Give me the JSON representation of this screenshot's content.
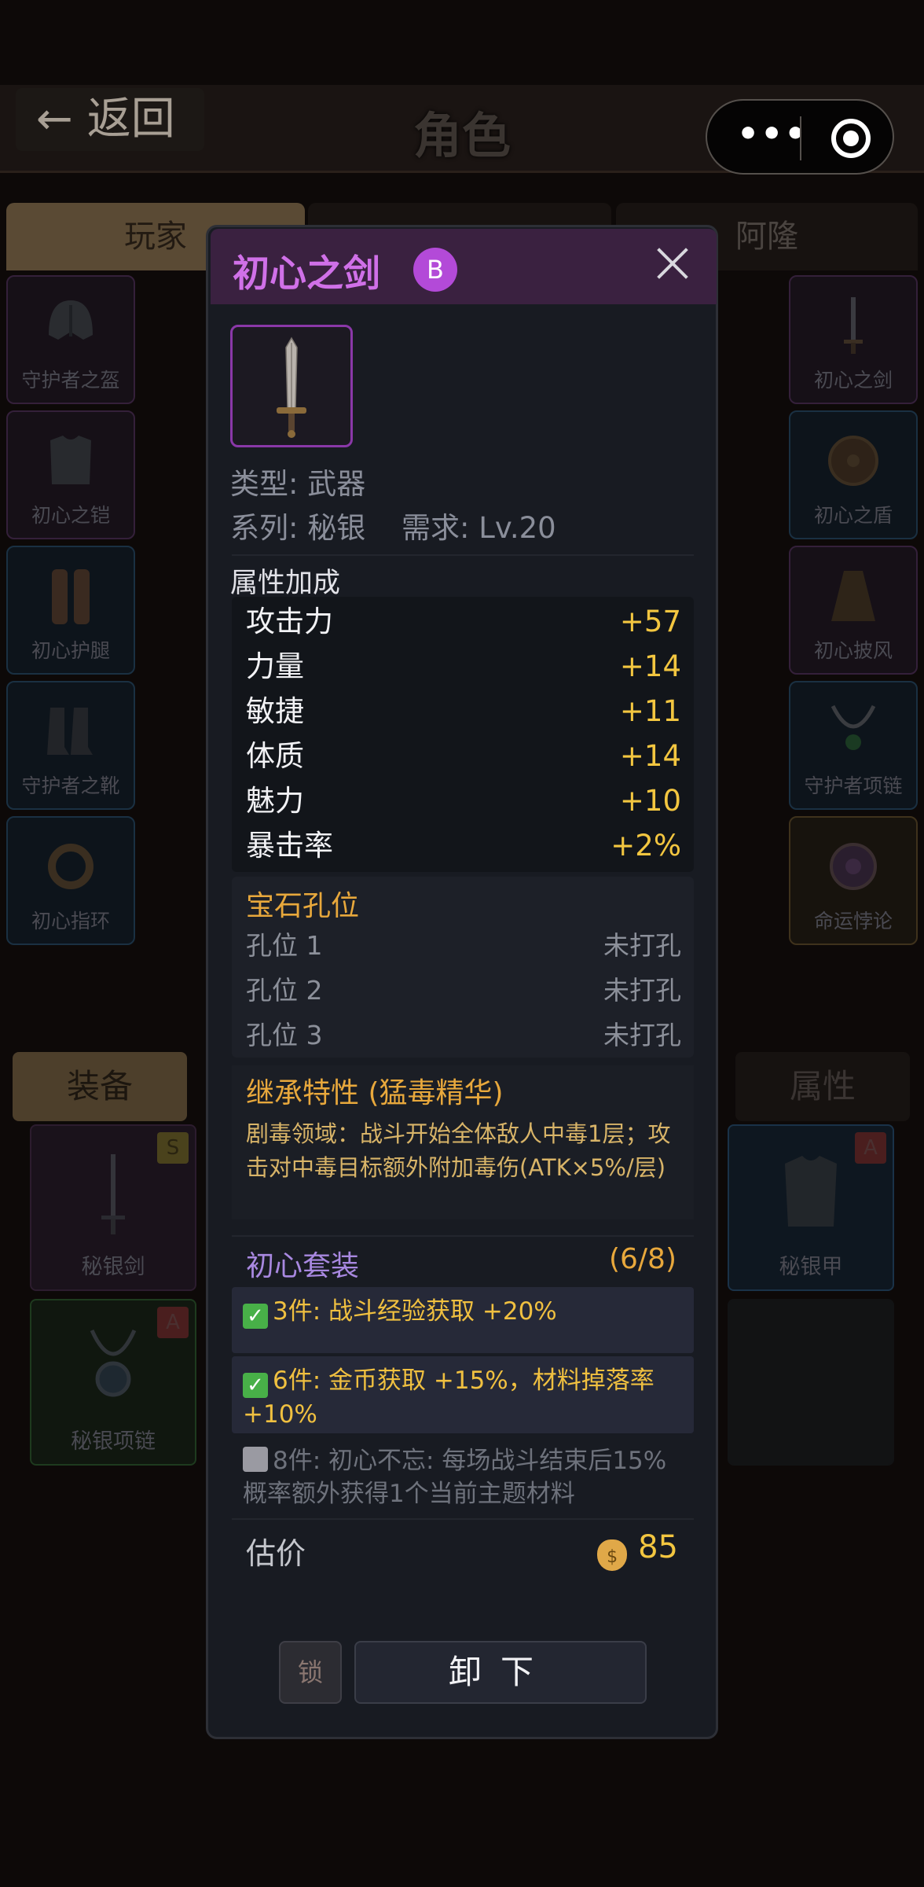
{
  "header": {
    "back_label": "← 返回",
    "title": "角色"
  },
  "tabs": {
    "player": "玩家",
    "middle": "",
    "alon": "阿隆"
  },
  "left_slots": [
    "守护者之盔",
    "初心之铠",
    "初心护腿",
    "守护者之靴",
    "初心指环"
  ],
  "right_slots": [
    "初心之剑",
    "初心之盾",
    "初心披风",
    "守护者项链",
    "命运悖论"
  ],
  "lower_tabs": {
    "equip": "装备",
    "attr": "属性"
  },
  "inventory": [
    {
      "label": "秘银剑",
      "rank": "S"
    },
    {
      "label": "秘银项链",
      "rank": "A"
    },
    {
      "label": "秘银甲",
      "rank": "A"
    }
  ],
  "item": {
    "name": "初心之剑",
    "grade": "B",
    "type_line": "类型: 武器",
    "series_line": "系列: 秘银",
    "req_line": "需求: Lv.20",
    "attr_title": "属性加成",
    "stats": [
      {
        "k": "攻击力",
        "v": "+57"
      },
      {
        "k": "力量",
        "v": "+14"
      },
      {
        "k": "敏捷",
        "v": "+11"
      },
      {
        "k": "体质",
        "v": "+14"
      },
      {
        "k": "魅力",
        "v": "+10"
      },
      {
        "k": "暴击率",
        "v": "+2%"
      }
    ],
    "gem_title": "宝石孔位",
    "gems": [
      {
        "k": "孔位 1",
        "v": "未打孔"
      },
      {
        "k": "孔位 2",
        "v": "未打孔"
      },
      {
        "k": "孔位 3",
        "v": "未打孔"
      }
    ],
    "inherit_title": "继承特性 (猛毒精华)",
    "inherit_desc": "剧毒领域：战斗开始全体敌人中毒1层；攻击对中毒目标额外附加毒伤(ATK×5%/层)",
    "set_title": "初心套装",
    "set_count": "(6/8)",
    "set_bonuses": [
      {
        "text": "3件: 战斗经验获取 +20%",
        "active": true
      },
      {
        "text": "6件: 金币获取 +15%，材料掉落率+10%",
        "active": true
      },
      {
        "text": "8件: 初心不忘: 每场战斗结束后15%概率额外获得1个当前主题材料",
        "active": false
      }
    ],
    "price_label": "估价",
    "price": "85",
    "lock_label": "锁",
    "unequip_label": "卸下"
  }
}
